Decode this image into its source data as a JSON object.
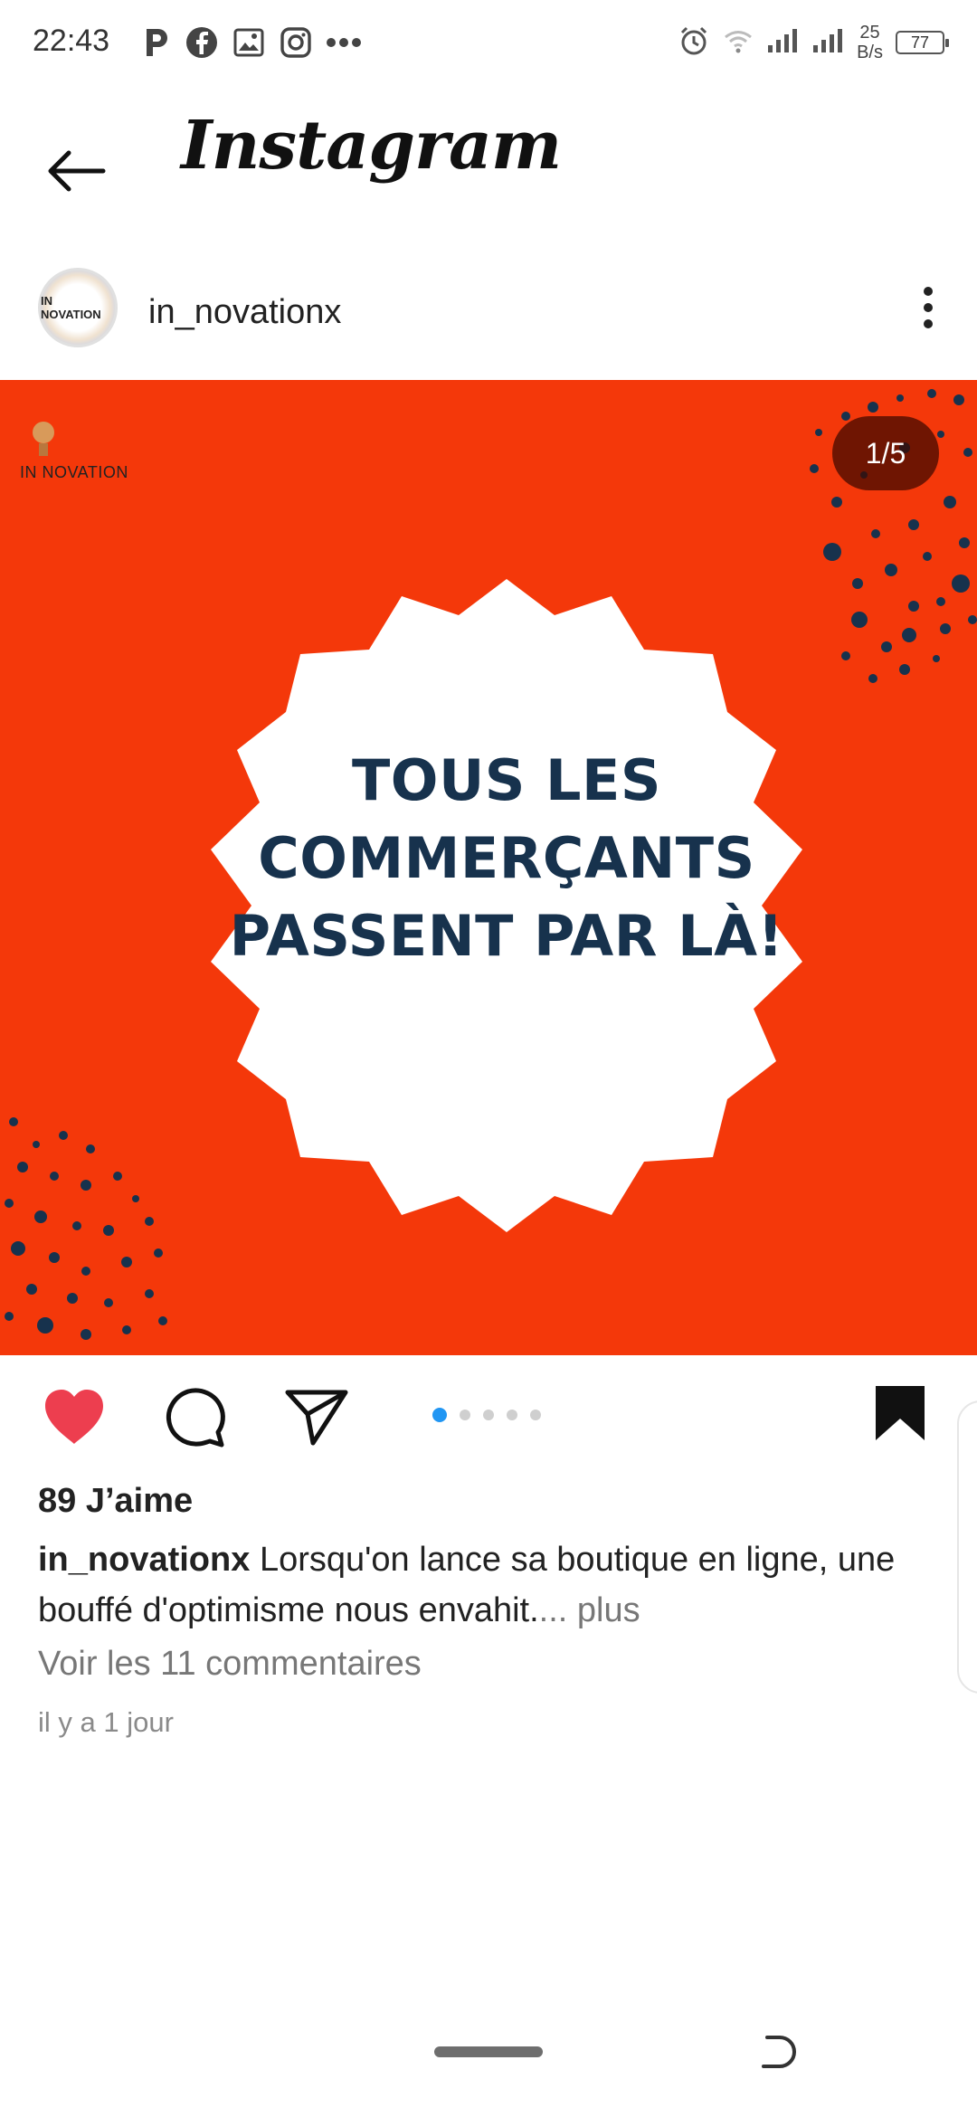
{
  "status_bar": {
    "time": "22:43",
    "net_speed_value": "25",
    "net_speed_unit": "B/s",
    "battery": "77",
    "app_icons": [
      "parking-p-icon",
      "facebook-icon",
      "gallery-icon",
      "instagram-icon",
      "more-dots-icon"
    ],
    "status_icons": [
      "alarm-icon",
      "wifi-icon",
      "signal-icon",
      "signal-icon"
    ]
  },
  "header": {
    "title": "Instagram"
  },
  "post": {
    "username": "in_novationx",
    "avatar_text": "IN NOVATION",
    "brand_text": "IN NOVATION",
    "image_counter": "1/5",
    "headline": [
      "TOUS LES",
      "COMMERÇANTS",
      "PASSENT PAR LÀ!"
    ],
    "colors": {
      "background": "#f4380a",
      "headline": "#17324d",
      "dots": "#17324d"
    },
    "carousel": {
      "total": 5,
      "current": 1
    },
    "liked": true,
    "saved": true,
    "likes": "89 J’aime",
    "caption_user": "in_novationx",
    "caption_text": "Lorsqu'on lance sa boutique en ligne, une bouffé d'optimisme nous envahit.",
    "caption_more": "... plus",
    "comments_link": "Voir les 11 commentaires",
    "time_ago": "il y a 1 jour"
  }
}
